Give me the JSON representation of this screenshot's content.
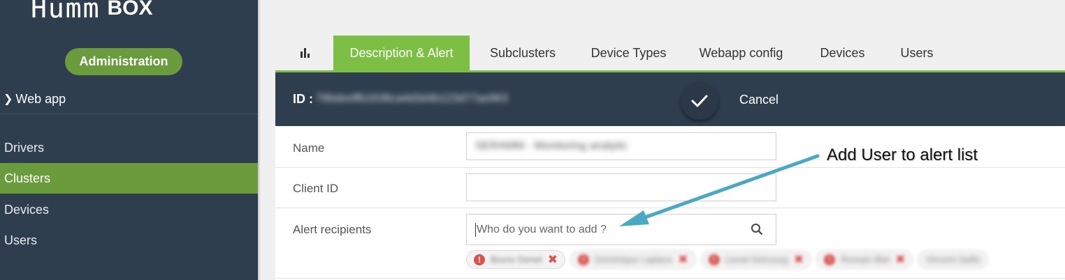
{
  "sidebar": {
    "logo_word": "Humm",
    "logo_box": "BOX",
    "admin_label": "Administration",
    "webapp_label": "Web app",
    "items": [
      {
        "label": "Drivers"
      },
      {
        "label": "Clusters"
      },
      {
        "label": "Devices"
      },
      {
        "label": "Users"
      }
    ],
    "active_item": "Clusters",
    "colors": {
      "background": "#2f3e4f",
      "accent": "#6a9b3c"
    }
  },
  "tabs": [
    {
      "icon": "bar-chart-icon"
    },
    {
      "label": "Description & Alert"
    },
    {
      "label": "Subclusters"
    },
    {
      "label": "Device Types"
    },
    {
      "label": "Webapp config"
    },
    {
      "label": "Devices"
    },
    {
      "label": "Users"
    }
  ],
  "active_tab": "Description & Alert",
  "header": {
    "id_label": "ID :",
    "id_value": "79bdeeffb1638ca4d3d4b123d77ae963",
    "confirm_icon": "check-icon",
    "cancel_label": "Cancel"
  },
  "form": {
    "name_label": "Name",
    "name_value": "SERAMM - Monitoring analytic",
    "client_id_label": "Client ID",
    "client_id_value": "",
    "alert_label": "Alert recipients",
    "alert_placeholder": "Who do you want to add ?",
    "recipients": [
      {
        "name": "Bruno Genet",
        "status": "error"
      },
      {
        "name": "Dominique Laplace"
      },
      {
        "name": "Lionel Delcourg"
      },
      {
        "name": "Romain Biel"
      },
      {
        "name": "Vincent Saillo"
      }
    ]
  },
  "annotation": {
    "text": "Add User to alert list",
    "color": "#4aa8c2"
  },
  "colors": {
    "tab_active": "#7dbf45"
  }
}
